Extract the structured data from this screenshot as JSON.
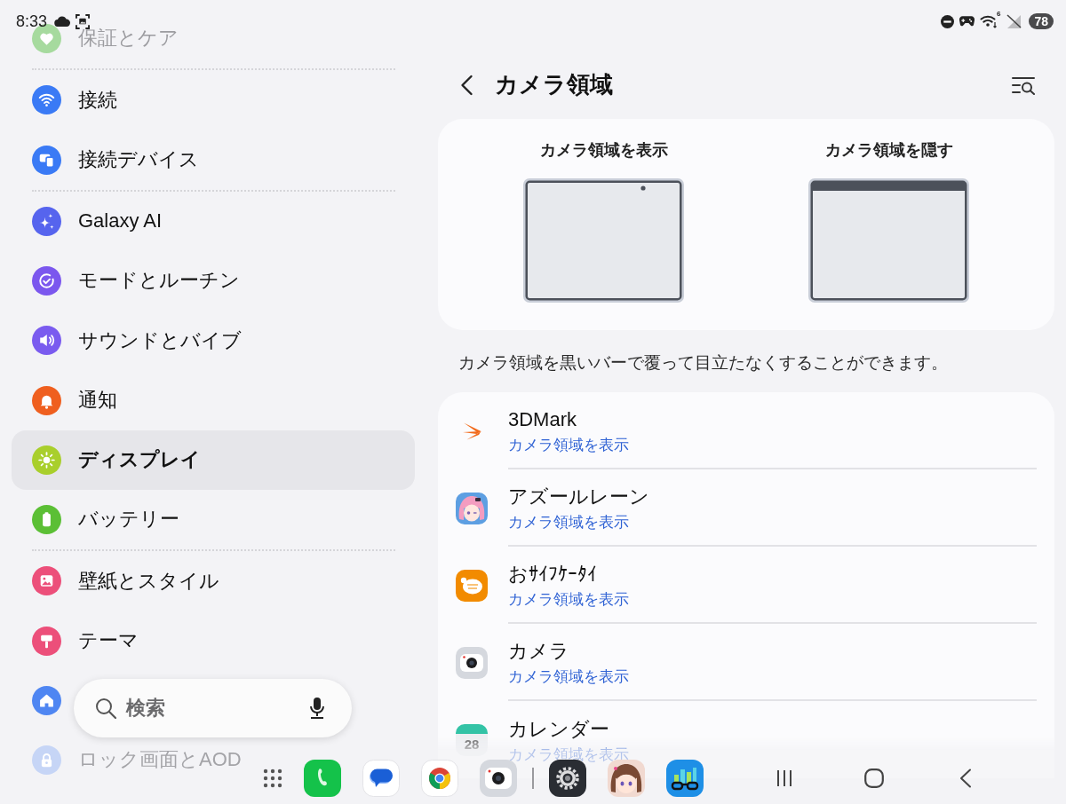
{
  "status_bar": {
    "time": "8:33",
    "wifi_generation": "6",
    "battery": "78"
  },
  "sidebar": {
    "groups": [
      {
        "items": [
          {
            "label": "保証とケア",
            "color": "#a6da9e",
            "selected": false
          }
        ]
      },
      {
        "items": [
          {
            "label": "接続",
            "color": "#3a7af5",
            "selected": false
          },
          {
            "label": "接続デバイス",
            "color": "#3a7af5",
            "selected": false
          }
        ]
      },
      {
        "items": [
          {
            "label": "Galaxy AI",
            "color": "#5664ee",
            "selected": false
          },
          {
            "label": "モードとルーチン",
            "color": "#7b57ee",
            "selected": false
          },
          {
            "label": "サウンドとバイブ",
            "color": "#7a5bef",
            "selected": false
          },
          {
            "label": "通知",
            "color": "#ef5f1f",
            "selected": false
          },
          {
            "label": "ディスプレイ",
            "color": "#a9cf2c",
            "selected": true
          },
          {
            "label": "バッテリー",
            "color": "#5bbf35",
            "selected": false
          }
        ]
      },
      {
        "items": [
          {
            "label": "壁紙とスタイル",
            "color": "#ec4f7a",
            "selected": false
          },
          {
            "label": "テーマ",
            "color": "#ec4f7a",
            "selected": false
          },
          {
            "color": "#4f86f2",
            "selected": false
          },
          {
            "label": "ロック画面とAOD",
            "color": "#c6d5f6",
            "selected": false
          }
        ]
      }
    ]
  },
  "search": {
    "label": "検索"
  },
  "header": {
    "title": "カメラ領域"
  },
  "preview": {
    "options": [
      {
        "label": "カメラ領域を表示",
        "kind": "cutout"
      },
      {
        "label": "カメラ領域を隠す",
        "kind": "bar"
      }
    ]
  },
  "description": "カメラ領域を黒いバーで覆って目立たなくすることができます。",
  "apps": [
    {
      "name": "3DMark",
      "setting": "カメラ領域を表示"
    },
    {
      "name": "アズールレーン",
      "setting": "カメラ領域を表示"
    },
    {
      "name": "おｻｲﾌｹｰﾀｲ",
      "setting": "カメラ領域を表示"
    },
    {
      "name": "カメラ",
      "setting": "カメラ領域を表示"
    },
    {
      "name": "カレンダー",
      "setting": "カメラ領域を表示",
      "icon_text": "28"
    }
  ]
}
